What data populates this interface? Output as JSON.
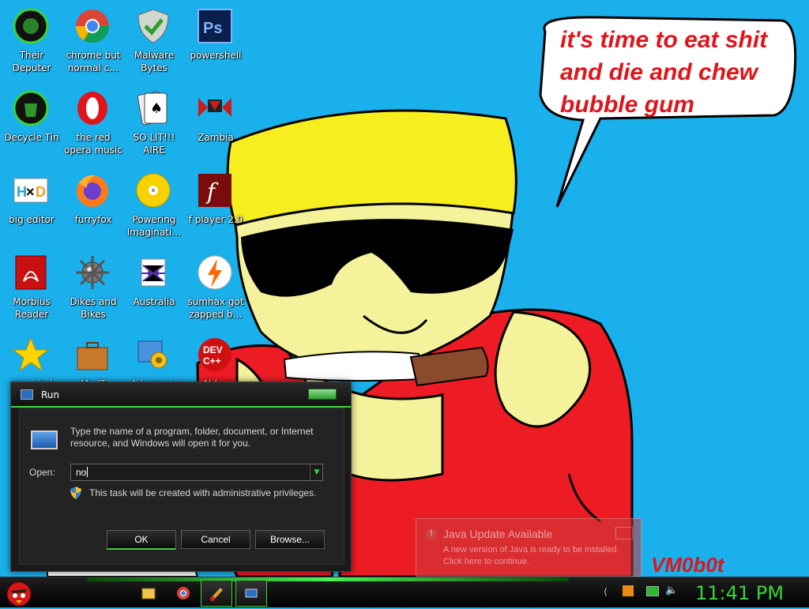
{
  "wallpaper": {
    "speech_lines": [
      "it's time to eat shit",
      "and die and chew",
      "bubble gum"
    ],
    "signature": "VM0b0t"
  },
  "desktop_icons": [
    {
      "label": "Their Deputer",
      "icon": "computer-icon"
    },
    {
      "label": "chrome but normal c…",
      "icon": "chrome-icon"
    },
    {
      "label": "Malware Bytes",
      "icon": "shield-check-icon"
    },
    {
      "label": "powershell",
      "icon": "photoshop-icon"
    },
    {
      "label": "Decycle Tin",
      "icon": "recycle-bin-icon"
    },
    {
      "label": "the red opera music",
      "icon": "opera-icon"
    },
    {
      "label": "SO LIT!!! AIRE",
      "icon": "solitaire-icon"
    },
    {
      "label": "Zambia",
      "icon": "flag-icon"
    },
    {
      "label": "big editor",
      "icon": "hex-editor-icon"
    },
    {
      "label": "furryfox",
      "icon": "firefox-icon"
    },
    {
      "label": "Powering Imaginati…",
      "icon": "disc-icon"
    },
    {
      "label": "f player 2.0",
      "icon": "flash-icon"
    },
    {
      "label": "Morbius Reader",
      "icon": "pdf-reader-icon"
    },
    {
      "label": "Dikes and Bikes",
      "icon": "mine-icon"
    },
    {
      "label": "Australia",
      "icon": "spider-icon"
    },
    {
      "label": "sumhax got zapped b…",
      "icon": "lightning-icon"
    },
    {
      "label": "you tried",
      "icon": "star-icon"
    },
    {
      "label": "My IT",
      "icon": "briefcase-icon"
    },
    {
      "label": "Advanced",
      "icon": "gears-icon"
    },
    {
      "label": "Ahlan",
      "icon": "devcpp-icon"
    }
  ],
  "run_dialog": {
    "title": "Run",
    "description": "Type the name of a program, folder, document, or Internet resource, and Windows will open it for you.",
    "open_label": "Open:",
    "open_value": "no",
    "admin_note": "This task will be created with administrative privileges.",
    "buttons": {
      "ok": "OK",
      "cancel": "Cancel",
      "browse": "Browse..."
    }
  },
  "java_popup": {
    "title": "Java Update Available",
    "body_line1": "A new version of Java is ready to be installed.",
    "body_line2": "Click here to continue."
  },
  "taskbar": {
    "clock": "11:41 PM",
    "items": [
      "explorer-icon",
      "chrome-icon",
      "paint-icon",
      "run-icon"
    ],
    "tray": [
      "arrow-icon",
      "java-icon",
      "network-icon",
      "volume-icon"
    ]
  },
  "colors": {
    "accent": "#3bd23b",
    "wallpaper": "#1ab0ec",
    "speech": "#e0141b"
  }
}
